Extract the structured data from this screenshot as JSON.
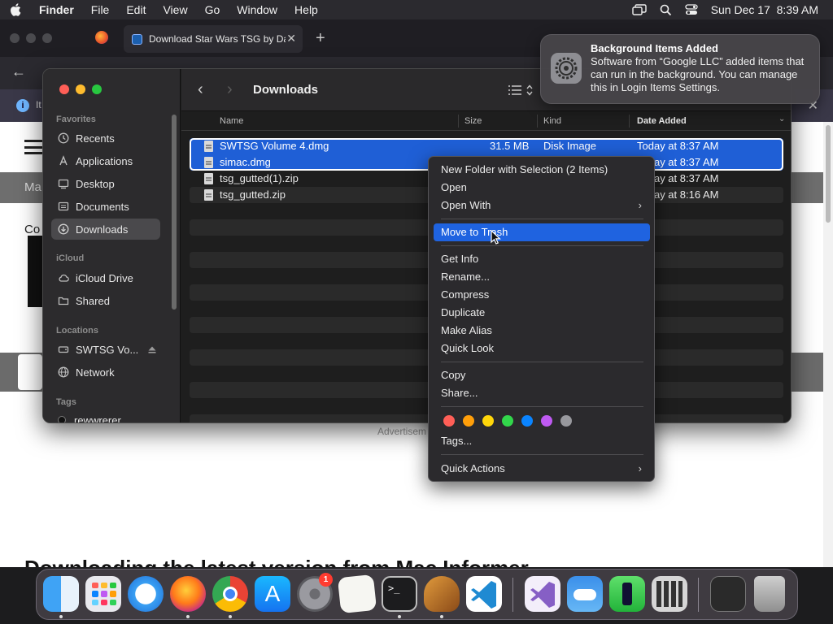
{
  "menubar": {
    "app_name": "Finder",
    "items": [
      "File",
      "Edit",
      "View",
      "Go",
      "Window",
      "Help"
    ],
    "datetime": "Sun Dec 17  8:39 AM"
  },
  "browser": {
    "tab_title": "Download Star Wars TSG by Da",
    "info_text": "It",
    "page_bar_text": "Ma",
    "page_text_co": "Co",
    "advert_text": "Advertisem",
    "bottom_heading": "Downloading the latest version from Mac Informer"
  },
  "finder": {
    "title": "Downloads",
    "sidebar": {
      "favorites_header": "Favorites",
      "favorites": [
        {
          "label": "Recents",
          "icon": "clock-icon"
        },
        {
          "label": "Applications",
          "icon": "applications-icon"
        },
        {
          "label": "Desktop",
          "icon": "desktop-icon"
        },
        {
          "label": "Documents",
          "icon": "document-icon"
        },
        {
          "label": "Downloads",
          "icon": "download-icon",
          "selected": true
        }
      ],
      "icloud_header": "iCloud",
      "icloud": [
        {
          "label": "iCloud Drive",
          "icon": "cloud-icon"
        },
        {
          "label": "Shared",
          "icon": "shared-folder-icon"
        }
      ],
      "locations_header": "Locations",
      "locations": [
        {
          "label": "SWTSG Vo...",
          "icon": "disk-icon"
        },
        {
          "label": "Network",
          "icon": "globe-icon"
        }
      ],
      "tags_header": "Tags",
      "tags": [
        {
          "label": "rewwrerer"
        }
      ]
    },
    "columns": {
      "name": "Name",
      "size": "Size",
      "kind": "Kind",
      "date": "Date Added"
    },
    "files": [
      {
        "name": "SWTSG Volume 4.dmg",
        "size": "31.5 MB",
        "kind": "Disk Image",
        "date": "Today at 8:37 AM",
        "selected": true
      },
      {
        "name": "simac.dmg",
        "size": "",
        "kind": "",
        "date": "Today at 8:37 AM",
        "selected": true
      },
      {
        "name": "tsg_gutted(1).zip",
        "size": "",
        "kind": "",
        "date": "Today at 8:37 AM",
        "selected": false
      },
      {
        "name": "tsg_gutted.zip",
        "size": "",
        "kind": "",
        "date": "Today at 8:16 AM",
        "selected": false
      }
    ]
  },
  "notification": {
    "title": "Background Items Added",
    "body": "Software from “Google LLC” added items that can run in the background. You can manage this in Login Items Settings."
  },
  "context_menu": {
    "items": {
      "new_folder": "New Folder with Selection (2 Items)",
      "open": "Open",
      "open_with": "Open With",
      "move_to_trash": "Move to Trash",
      "get_info": "Get Info",
      "rename": "Rename...",
      "compress": "Compress",
      "duplicate": "Duplicate",
      "make_alias": "Make Alias",
      "quick_look": "Quick Look",
      "copy": "Copy",
      "share": "Share...",
      "tags": "Tags...",
      "quick_actions": "Quick Actions"
    },
    "highlighted": "Move to Trash",
    "tag_colors": [
      "#ff5f57",
      "#ff9f0a",
      "#ffd60a",
      "#32d74b",
      "#0a84ff",
      "#bf5af2",
      "#98989d"
    ]
  },
  "dock": {
    "apps": [
      "Finder",
      "Launchpad",
      "Safari",
      "Firefox",
      "Chrome",
      "App Store",
      "System Settings",
      "TextEdit",
      "Terminal",
      "Instruments",
      "Visual Studio Code",
      "Visual Studio",
      "Weather",
      "FaceTime",
      "Calculator",
      "Screenshot",
      "Trash"
    ],
    "settings_badge": "1"
  },
  "colors": {
    "selection": "#1f5fd6",
    "menu_highlight": "#1f63e0",
    "sidebar_bg": "#2c2b2d"
  }
}
